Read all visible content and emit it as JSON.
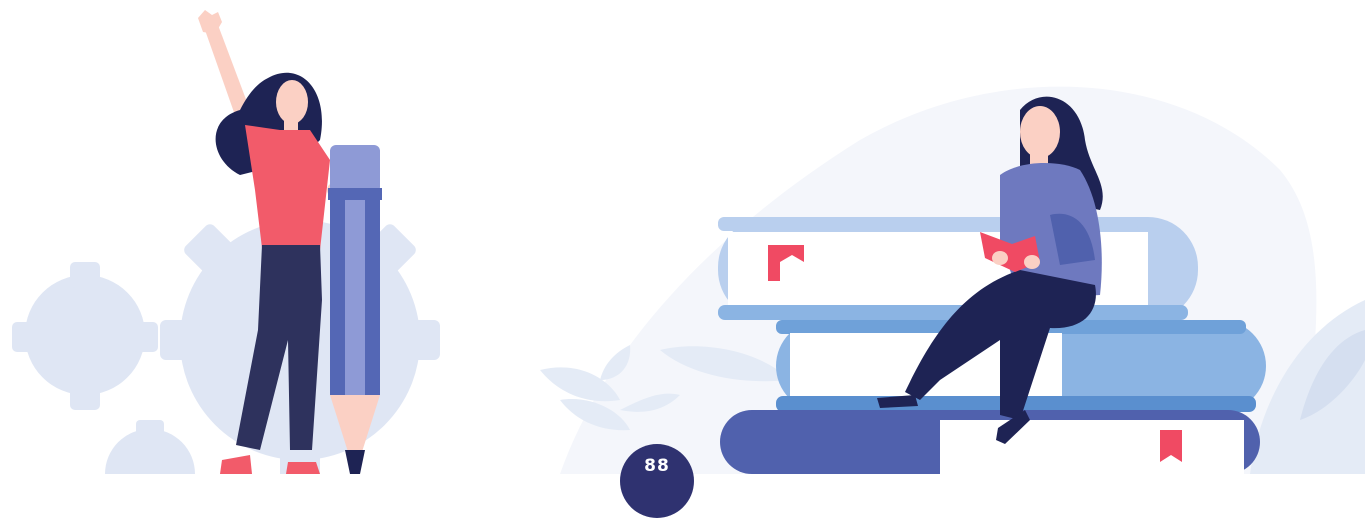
{
  "illustration": {
    "badge_text": "88",
    "colors": {
      "background": "#ffffff",
      "backdrop_blob": "#f4f6fb",
      "gear": "#dfe6f4",
      "leaf": "#e4ebf6",
      "skin": "#fbd0c4",
      "hair": "#1e2354",
      "shirt_red": "#f25b6a",
      "pants": "#2e325d",
      "pencil_body": "#5467b5",
      "pencil_light": "#8e9ad6",
      "sweater": "#6e79bf",
      "book_light": "#b9cfee",
      "book_mid": "#8bb4e3",
      "book_dark": "#5061ad",
      "bookmark": "#f04a63",
      "badge": "#2f3270"
    }
  }
}
